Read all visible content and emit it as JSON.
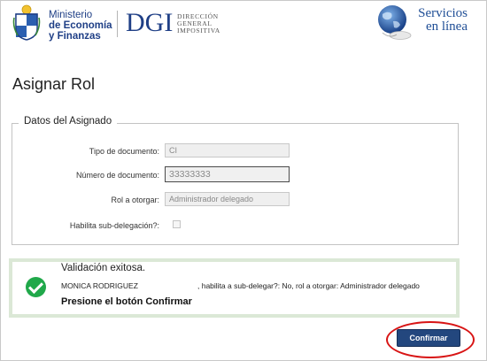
{
  "header": {
    "ministry": [
      "Ministerio",
      "de Economía",
      "y Finanzas"
    ],
    "dgi": "DGI",
    "dgi_sub": [
      "Dirección",
      "General",
      "Impositiva"
    ],
    "services": [
      "Servicios",
      "en línea"
    ]
  },
  "page_title": "Asignar Rol",
  "fieldset": {
    "legend": "Datos del Asignado",
    "fields": {
      "tipo_label": "Tipo de documento:",
      "tipo_value": "CI",
      "numero_label": "Número de documento:",
      "numero_value": "33333333",
      "rol_label": "Rol a otorgar:",
      "rol_value": "Administrador delegado",
      "habilita_label": "Habilita sub-delegación?:",
      "habilita_checked": false
    }
  },
  "success": {
    "title": "Validación exitosa.",
    "name": "MONICA RODRIGUEZ",
    "detail": ", habilita a sub-delegar?: No, rol a otorgar: Administrador delegado",
    "cta": "Presione el botón Confirmar"
  },
  "actions": {
    "confirm_label": "Confirmar"
  },
  "colors": {
    "brand": "#1f3f86",
    "button": "#23477e",
    "success": "#20a84a",
    "success_border": "#dbe8d6",
    "highlight": "#d81414"
  }
}
